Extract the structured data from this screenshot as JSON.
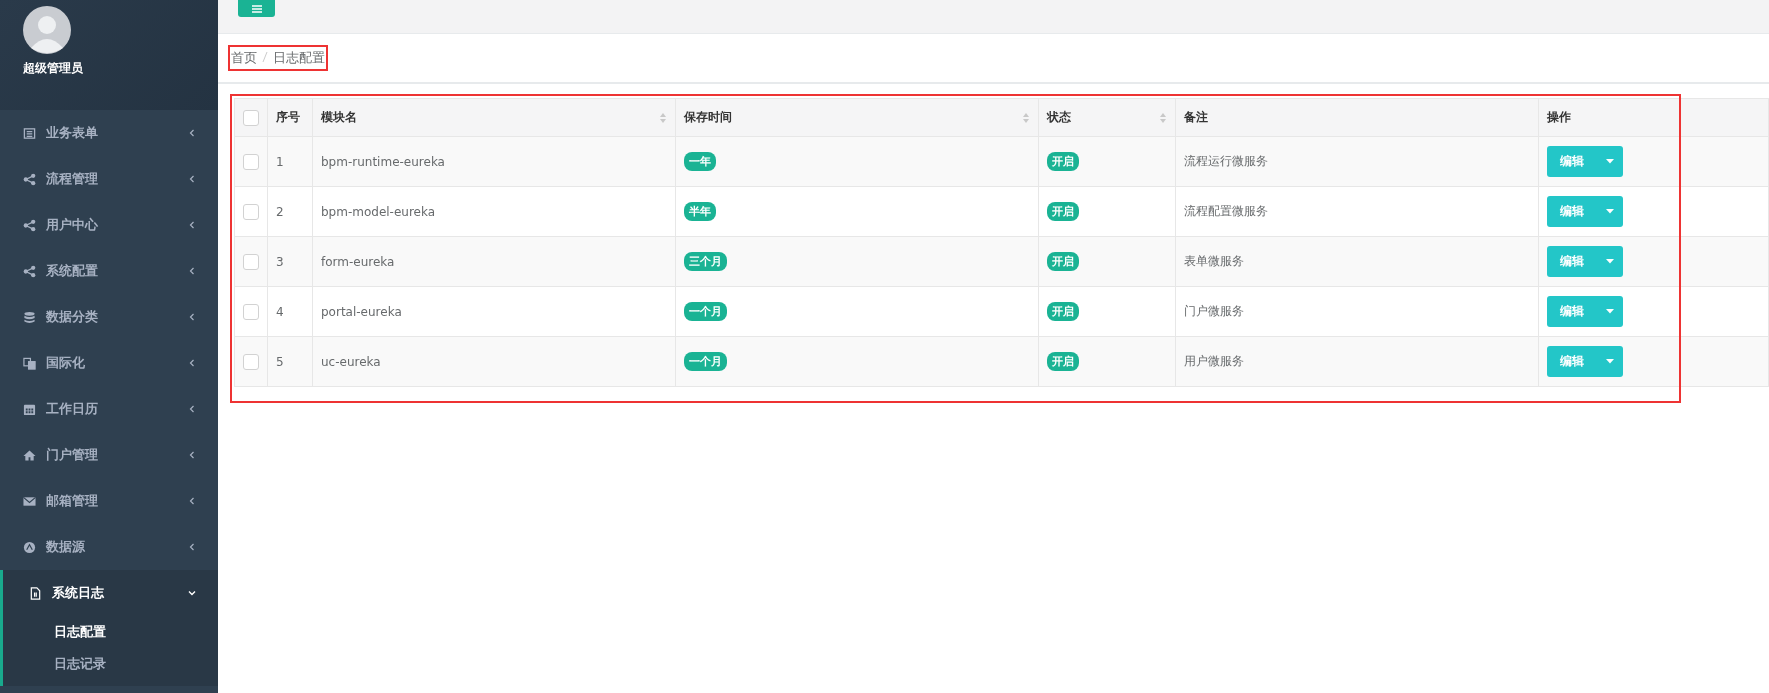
{
  "sidebar": {
    "user": {
      "name": "超级管理员"
    },
    "menu": [
      {
        "label": "业务表单",
        "expanded": false
      },
      {
        "label": "流程管理",
        "expanded": false
      },
      {
        "label": "用户中心",
        "expanded": false
      },
      {
        "label": "系统配置",
        "expanded": false
      },
      {
        "label": "数据分类",
        "expanded": false
      },
      {
        "label": "国际化",
        "expanded": false
      },
      {
        "label": "工作日历",
        "expanded": false
      },
      {
        "label": "门户管理",
        "expanded": false
      },
      {
        "label": "邮箱管理",
        "expanded": false
      },
      {
        "label": "数据源",
        "expanded": false
      },
      {
        "label": "系统日志",
        "expanded": true,
        "children": [
          {
            "label": "日志配置",
            "selected": true
          },
          {
            "label": "日志记录",
            "selected": false
          }
        ]
      }
    ]
  },
  "breadcrumb": {
    "highlighted": true,
    "items": [
      "首页",
      "日志配置"
    ]
  },
  "table": {
    "highlighted": true,
    "header_checked": false,
    "columns": [
      {
        "label": "序号",
        "sortable": false
      },
      {
        "label": "模块名",
        "sortable": true
      },
      {
        "label": "保存时间",
        "sortable": true
      },
      {
        "label": "状态",
        "sortable": true
      },
      {
        "label": "备注",
        "sortable": false
      },
      {
        "label": "操作",
        "sortable": false
      }
    ],
    "rows": [
      {
        "checked": false,
        "index": "1",
        "module": "bpm-runtime-eureka",
        "retention": "一年",
        "status": "开启",
        "note": "流程运行微服务",
        "action": "编辑"
      },
      {
        "checked": false,
        "index": "2",
        "module": "bpm-model-eureka",
        "retention": "半年",
        "status": "开启",
        "note": "流程配置微服务",
        "action": "编辑"
      },
      {
        "checked": false,
        "index": "3",
        "module": "form-eureka",
        "retention": "三个月",
        "status": "开启",
        "note": "表单微服务",
        "action": "编辑"
      },
      {
        "checked": false,
        "index": "4",
        "module": "portal-eureka",
        "retention": "一个月",
        "status": "开启",
        "note": "门户微服务",
        "action": "编辑"
      },
      {
        "checked": false,
        "index": "5",
        "module": "uc-eureka",
        "retention": "一个月",
        "status": "开启",
        "note": "用户微服务",
        "action": "编辑"
      }
    ]
  }
}
